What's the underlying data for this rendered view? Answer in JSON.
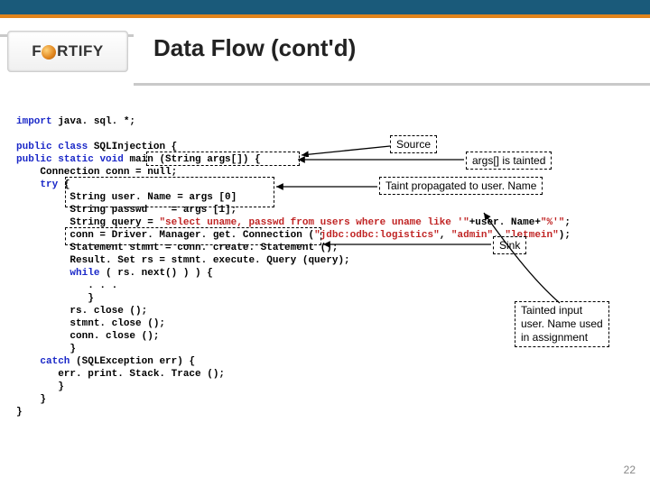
{
  "logo_text_pre": "F",
  "logo_text_post": "RTIFY",
  "title": "Data Flow (cont'd)",
  "slide_number": "22",
  "code": {
    "l01a": "import",
    "l01b": " java. sql. *;",
    "l02a": "public",
    "l02b": " ",
    "l02c": "class",
    "l02d": " SQLInjection {",
    "l03a": "public",
    "l03b": " ",
    "l03c": "static",
    "l03d": " ",
    "l03e": "void",
    "l03f": " main (String args[]) {",
    "l04": "    Connection conn = null;",
    "l05a": "    ",
    "l05b": "try",
    "l05c": " {",
    "l06": "         String user. Name = args [0]",
    "l07": "         String passwd    = args [1];",
    "l08a": "         String query = ",
    "l08b": "\"select uname, passwd from users where uname like '\"",
    "l08c": "+user. Name+",
    "l08d": "\"%'\"",
    "l08e": ";",
    "l09a": "         conn = Driver. Manager. get. Connection (",
    "l09b": "\"jdbc:odbc:logistics\"",
    "l09c": ", ",
    "l09d": "\"admin\"",
    "l09e": ", ",
    "l09f": "\"letmein\"",
    "l09g": ");",
    "l10": "         Statement stmnt = conn. create. Statement ();",
    "l11": "         Result. Set rs = stmnt. execute. Query (query);",
    "l12a": "         ",
    "l12b": "while",
    "l12c": " ( rs. next() ) ) {",
    "l13": "            . . .",
    "l14": "            }",
    "l15": "         rs. close ();",
    "l16": "         stmnt. close ();",
    "l17": "         conn. close ();",
    "l18": "         }",
    "l19a": "    ",
    "l19b": "catch",
    "l19c": " (SQLException err) {",
    "l20": "       err. print. Stack. Trace ();",
    "l21": "       }",
    "l22": "    }",
    "l23": "}"
  },
  "callouts": {
    "source": "Source",
    "args_tainted": "args[] is tainted",
    "taint_prop": "Taint propagated to user. Name",
    "sink": "Sink",
    "tainted_input": "Tainted input\nuser. Name used\nin assignment"
  }
}
